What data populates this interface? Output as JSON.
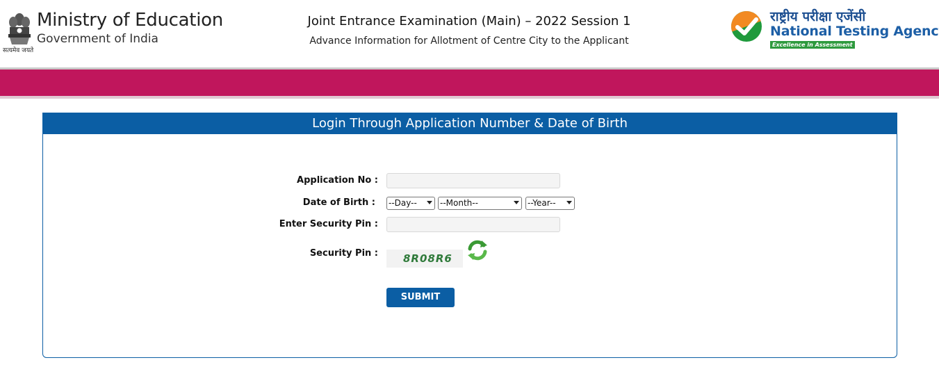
{
  "header": {
    "emblem_motto": "सत्यमेव जयते",
    "ministry_title": "Ministry of Education",
    "ministry_subtitle": "Government of India",
    "exam_title": "Joint Entrance Examination (Main) – 2022 Session 1",
    "exam_subtitle": "Advance Information for Allotment of Centre City to the Applicant",
    "agency_hindi": "राष्ट्रीय परीक्षा एजेंसी",
    "agency_name": "National Testing Agency",
    "agency_tagline": "Excellence in Assessment"
  },
  "form": {
    "heading": "Login Through Application Number & Date of Birth",
    "application_no_label": "Application No :",
    "application_no_value": "",
    "dob_label": "Date of Birth :",
    "day_selected": "--Day--",
    "month_selected": "--Month--",
    "year_selected": "--Year--",
    "security_pin_input_label": "Enter Security Pin :",
    "security_pin_input_value": "",
    "security_pin_label": "Security Pin :",
    "captcha_text": "8R08R6",
    "submit_label": "SUBMIT"
  },
  "icons": {
    "emblem": "national-emblem-icon",
    "agency_logo": "nta-check-logo-icon",
    "refresh": "refresh-icon"
  },
  "colors": {
    "band": "#c0165c",
    "primary_blue": "#0b5ea4",
    "agency_blue": "#1d5fa6",
    "agency_green": "#2e9a3e",
    "logo_orange": "#f28a22"
  }
}
